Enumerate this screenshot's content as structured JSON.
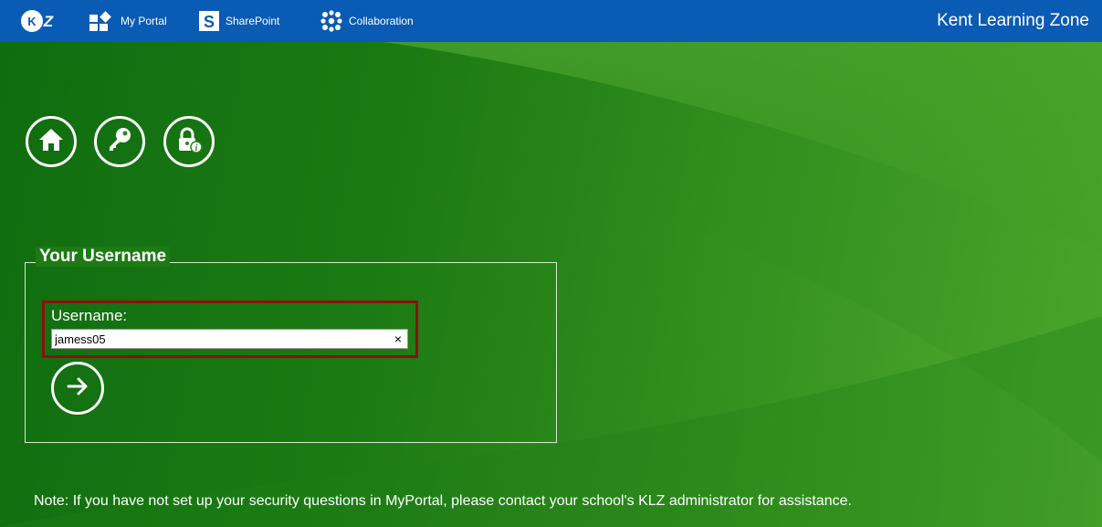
{
  "topbar": {
    "logo_text": "KLZ",
    "nav": [
      {
        "label": "My Portal",
        "icon": "my-portal-icon"
      },
      {
        "label": "SharePoint",
        "icon": "sharepoint-icon"
      },
      {
        "label": "Collaboration",
        "icon": "collaboration-icon"
      }
    ],
    "site_title": "Kent Learning Zone"
  },
  "actions": [
    {
      "icon": "home-icon"
    },
    {
      "icon": "key-icon"
    },
    {
      "icon": "lock-info-icon"
    }
  ],
  "form": {
    "legend": "Your Username",
    "username_label": "Username:",
    "username_value": "jamess05",
    "clear_glyph": "×",
    "submit_icon": "arrow-right-icon"
  },
  "note": "Note: If you have not set up your security questions in MyPortal, please contact your school's KLZ administrator for assistance.",
  "colors": {
    "topbar": "#0a5bb4",
    "background_green": "#2f8a17",
    "highlight_border": "#8e0f0f"
  }
}
